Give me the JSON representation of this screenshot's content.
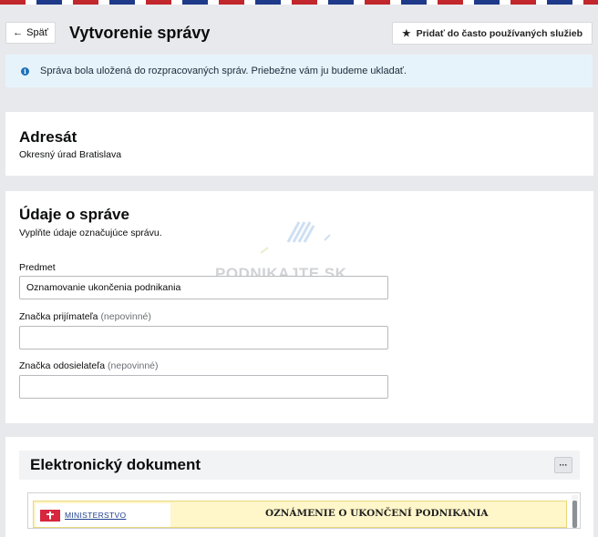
{
  "header": {
    "back_label": "Späť",
    "title": "Vytvorenie správy",
    "favorite_label": "Pridať do často používaných služieb"
  },
  "info_banner": {
    "text": "Správa bola uložená do rozpracovaných správ. Priebežne vám ju budeme ukladať."
  },
  "recipient": {
    "heading": "Adresát",
    "name": "Okresný úrad Bratislava"
  },
  "message_details": {
    "heading": "Údaje o správe",
    "hint": "Vyplňte údaje označujúce správu.",
    "subject_label": "Predmet",
    "subject_value": "Oznamovanie ukončenia podnikania",
    "recipient_ref_label": "Značka prijímateľa",
    "recipient_ref_optional": "(nepovinné)",
    "recipient_ref_value": "",
    "sender_ref_label": "Značka odosielateľa",
    "sender_ref_optional": "(nepovinné)",
    "sender_ref_value": ""
  },
  "watermark": {
    "text": "PODNIKAJTE.SK"
  },
  "electronic_document": {
    "heading": "Elektronický dokument",
    "more_label": "···",
    "ministry_label": "MINISTERSTVO",
    "doc_title": "OZNÁMENIE O UKONČENÍ PODNIKANIA"
  },
  "colors": {
    "background": "#e8e9ec",
    "info_background": "#e6f3fb",
    "info_icon": "#1d70b8",
    "document_banner": "#fff6c9"
  }
}
